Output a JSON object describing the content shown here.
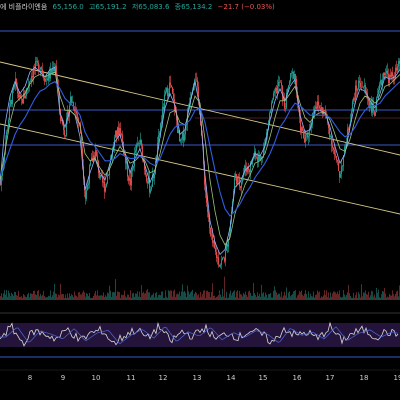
{
  "header": {
    "title": "에 비플라이엔움",
    "open": "65,156.0",
    "high": "고65,191.2",
    "low": "저65,083.6",
    "close": "종65,134.2",
    "change": "−21.7 (−0.03%)"
  },
  "colors": {
    "background": "#000000",
    "up": "#26a69a",
    "down": "#ef5350",
    "trendline": "#d8c98a",
    "level_line": "#3d57c9",
    "ma_fast": "#8fb3ff",
    "ma_mid": "#9ec27a",
    "ma_slow": "#2f5fe0",
    "oscillator": "#d8d8d8",
    "oscillator_band": "#2a1747"
  },
  "chart_data": {
    "type": "line",
    "subtype": "candlestick",
    "x": [
      "8",
      "9",
      "10",
      "11",
      "12",
      "13",
      "14",
      "15",
      "16",
      "17",
      "18",
      "19"
    ],
    "xlabel": "",
    "ylabel": "",
    "grid": false,
    "price": [
      0.48,
      0.66,
      0.82,
      0.9,
      0.82,
      0.86,
      0.93,
      0.97,
      0.98,
      0.92,
      0.94,
      0.99,
      0.76,
      0.7,
      0.84,
      0.8,
      0.71,
      0.42,
      0.56,
      0.62,
      0.5,
      0.47,
      0.58,
      0.68,
      0.72,
      0.58,
      0.48,
      0.62,
      0.66,
      0.54,
      0.46,
      0.55,
      0.72,
      0.85,
      0.9,
      0.79,
      0.64,
      0.71,
      0.85,
      0.95,
      0.78,
      0.47,
      0.27,
      0.2,
      0.15,
      0.18,
      0.3,
      0.52,
      0.48,
      0.55,
      0.55,
      0.62,
      0.58,
      0.65,
      0.78,
      0.86,
      0.91,
      0.8,
      0.92,
      0.95,
      0.73,
      0.66,
      0.71,
      0.82,
      0.8,
      0.78,
      0.7,
      0.6,
      0.52,
      0.62,
      0.75,
      0.86,
      0.91,
      0.88,
      0.82,
      0.78,
      0.88,
      0.96,
      0.92,
      0.94,
      0.98
    ],
    "oscillator": [
      0.45,
      0.7,
      0.3,
      0.6,
      0.52,
      0.4,
      0.66,
      0.35,
      0.55,
      0.62,
      0.28,
      0.5,
      0.64,
      0.42,
      0.72,
      0.33,
      0.58,
      0.47,
      0.69,
      0.38,
      0.56,
      0.44,
      0.61,
      0.52,
      0.3,
      0.67,
      0.49,
      0.57,
      0.4,
      0.71,
      0.36,
      0.54,
      0.63,
      0.45,
      0.58,
      0.5
    ],
    "series": [
      {
        "values": [
          0.48,
          0.73,
          0.85,
          0.91,
          0.86,
          0.89,
          0.95,
          0.97,
          0.95,
          0.93,
          0.96,
          0.97,
          0.78,
          0.72,
          0.79,
          0.77,
          0.68,
          0.46,
          0.53,
          0.59,
          0.53,
          0.5,
          0.57,
          0.66,
          0.69,
          0.61,
          0.53,
          0.59,
          0.63,
          0.56,
          0.49,
          0.54,
          0.68,
          0.8,
          0.86,
          0.81,
          0.69,
          0.71,
          0.82,
          0.91,
          0.8,
          0.52,
          0.33,
          0.24,
          0.19,
          0.21,
          0.3,
          0.47,
          0.49,
          0.54,
          0.56,
          0.61,
          0.6,
          0.64,
          0.75,
          0.83,
          0.88,
          0.83,
          0.89,
          0.92,
          0.77,
          0.7,
          0.71,
          0.79,
          0.79,
          0.78,
          0.72,
          0.64,
          0.57,
          0.61,
          0.72,
          0.82,
          0.88,
          0.87,
          0.83,
          0.8,
          0.86,
          0.93,
          0.92,
          0.93,
          0.96
        ]
      },
      {
        "values": [
          0.5,
          0.62,
          0.74,
          0.82,
          0.84,
          0.86,
          0.9,
          0.93,
          0.94,
          0.93,
          0.94,
          0.95,
          0.85,
          0.79,
          0.79,
          0.77,
          0.73,
          0.61,
          0.58,
          0.59,
          0.55,
          0.52,
          0.55,
          0.6,
          0.64,
          0.61,
          0.57,
          0.58,
          0.6,
          0.58,
          0.53,
          0.54,
          0.61,
          0.7,
          0.78,
          0.79,
          0.74,
          0.73,
          0.78,
          0.85,
          0.82,
          0.67,
          0.5,
          0.37,
          0.27,
          0.23,
          0.26,
          0.36,
          0.42,
          0.48,
          0.52,
          0.57,
          0.58,
          0.61,
          0.68,
          0.76,
          0.83,
          0.83,
          0.86,
          0.89,
          0.82,
          0.76,
          0.74,
          0.77,
          0.78,
          0.78,
          0.75,
          0.69,
          0.63,
          0.62,
          0.67,
          0.75,
          0.82,
          0.85,
          0.84,
          0.82,
          0.84,
          0.89,
          0.9,
          0.92,
          0.94
        ]
      },
      {
        "values": [
          0.52,
          0.57,
          0.63,
          0.69,
          0.73,
          0.76,
          0.8,
          0.84,
          0.87,
          0.88,
          0.9,
          0.91,
          0.88,
          0.84,
          0.82,
          0.8,
          0.77,
          0.7,
          0.66,
          0.64,
          0.61,
          0.58,
          0.58,
          0.59,
          0.61,
          0.6,
          0.59,
          0.59,
          0.6,
          0.59,
          0.57,
          0.56,
          0.59,
          0.64,
          0.69,
          0.72,
          0.73,
          0.73,
          0.75,
          0.79,
          0.8,
          0.74,
          0.64,
          0.54,
          0.45,
          0.38,
          0.35,
          0.37,
          0.4,
          0.44,
          0.47,
          0.51,
          0.54,
          0.57,
          0.61,
          0.66,
          0.72,
          0.75,
          0.79,
          0.82,
          0.81,
          0.79,
          0.77,
          0.77,
          0.77,
          0.77,
          0.76,
          0.73,
          0.7,
          0.68,
          0.69,
          0.72,
          0.76,
          0.79,
          0.81,
          0.81,
          0.82,
          0.85,
          0.87,
          0.89,
          0.91
        ]
      }
    ]
  }
}
